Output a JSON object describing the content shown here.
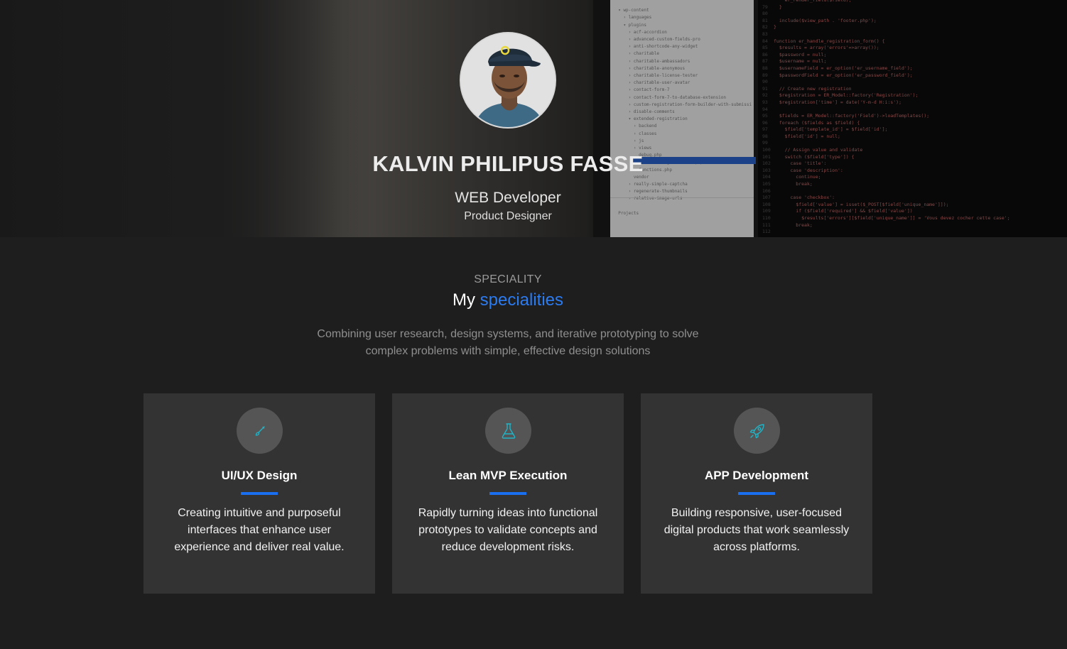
{
  "hero": {
    "name": "KALVIN PHILIPUS FASSE",
    "role": "WEB Developer",
    "subrole": "Product Designer"
  },
  "speciality": {
    "eyebrow": "SPECIALITY",
    "heading_plain": "My",
    "heading_accent": "specialities",
    "lead_line1": "Combining user research, design systems, and iterative prototyping to solve",
    "lead_line2": "complex problems with simple, effective design solutions",
    "cards": [
      {
        "icon": "brush-icon",
        "title": "UI/UX Design",
        "text": "Creating intuitive and purposeful interfaces that enhance user experience and deliver real value."
      },
      {
        "icon": "flask-icon",
        "title": "Lean MVP Execution",
        "text": "Rapidly turning ideas into functional prototypes to validate concepts and reduce development risks."
      },
      {
        "icon": "rocket-icon",
        "title": "APP Development",
        "text": "Building responsive, user-focused digital products that work seamlessly across platforms."
      }
    ]
  },
  "colors": {
    "accent": "#2b7bf1",
    "icon_teal": "#1fb5c8",
    "card_bg": "#333333",
    "page_bg": "#1e1e1e"
  }
}
